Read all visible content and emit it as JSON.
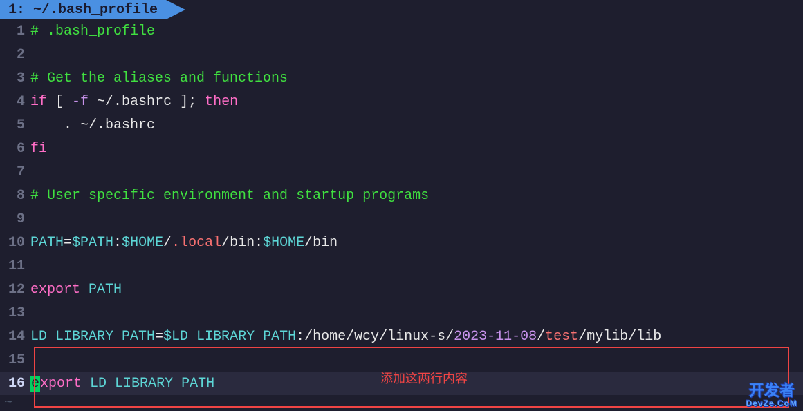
{
  "tab": {
    "label": "1: ~/.bash_profile"
  },
  "lines": {
    "l1": {
      "num": "1",
      "comment": "# .bash_profile"
    },
    "l2": {
      "num": "2"
    },
    "l3": {
      "num": "3",
      "comment": "# Get the aliases and functions"
    },
    "l4": {
      "num": "4",
      "kw_if": "if",
      "bracket_l": " [ ",
      "flag": "-f",
      "path": " ~/.bashrc ",
      "bracket_r": "]",
      "semi_then": "; ",
      "then": "then"
    },
    "l5": {
      "num": "5",
      "dot": "    . ",
      "path": "~/.bashrc"
    },
    "l6": {
      "num": "6",
      "kw_fi": "fi"
    },
    "l7": {
      "num": "7"
    },
    "l8": {
      "num": "8",
      "comment": "# User specific environment and startup programs"
    },
    "l9": {
      "num": "9"
    },
    "l10": {
      "num": "10",
      "var": "PATH",
      "eq": "=",
      "val1": "$PATH",
      "c1": ":",
      "val2": "$HOME",
      "c2": "/",
      "local": ".local",
      "c3": "/bin:",
      "val3": "$HOME",
      "c4": "/bin"
    },
    "l11": {
      "num": "11"
    },
    "l12": {
      "num": "12",
      "kw": "export",
      "sp": " ",
      "var": "PATH"
    },
    "l13": {
      "num": "13"
    },
    "l14": {
      "num": "14",
      "var": "LD_LIBRARY_PATH",
      "eq": "=",
      "val1": "$LD_LIBRARY_PATH",
      "c1": ":/home/wcy/linux-s/",
      "date": "2023-11-08",
      "c2": "/",
      "test": "test",
      "c3": "/mylib/lib"
    },
    "l15": {
      "num": "15"
    },
    "l16": {
      "num": "16",
      "cursor": "e",
      "xport": "xport",
      "sp": " ",
      "var": "LD_LIBRARY_PATH"
    }
  },
  "annotation": "添加这两行内容",
  "watermark": {
    "main": "开发者",
    "sub": "DevZe.CoM"
  },
  "tilde": "~"
}
